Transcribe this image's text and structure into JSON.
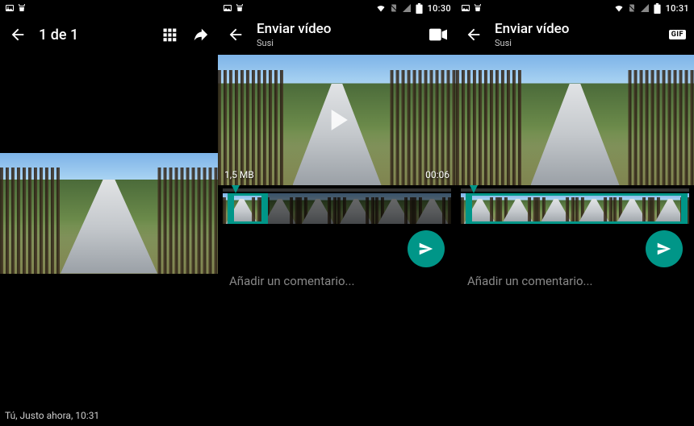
{
  "status": {
    "time2": "10:30",
    "time3": "10:31"
  },
  "screen1": {
    "counter": "1 de 1",
    "footer": "Tú, Justo ahora, 10:31"
  },
  "screen2": {
    "title": "Enviar vídeo",
    "subtitle": "Susi",
    "filesize": "1,5 MB",
    "duration": "00:06",
    "comment_placeholder": "Añadir un comentario..."
  },
  "screen3": {
    "title": "Enviar vídeo",
    "subtitle": "Susi",
    "gif_label": "GIF",
    "comment_placeholder": "Añadir un comentario..."
  }
}
